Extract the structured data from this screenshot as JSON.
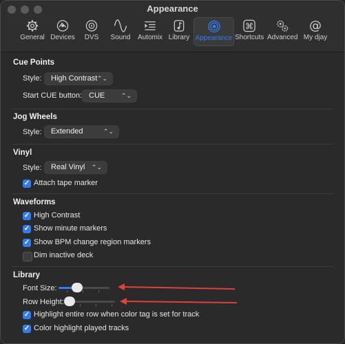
{
  "window": {
    "title": "Appearance"
  },
  "toolbar": {
    "items": [
      {
        "label": "General",
        "icon": "gear-icon"
      },
      {
        "label": "Devices",
        "icon": "headphones-icon"
      },
      {
        "label": "DVS",
        "icon": "vinyl-icon"
      },
      {
        "label": "Sound",
        "icon": "waveform-icon"
      },
      {
        "label": "Automix",
        "icon": "automix-icon"
      },
      {
        "label": "Library",
        "icon": "music-note-icon"
      },
      {
        "label": "Appearance",
        "icon": "eye-icon"
      },
      {
        "label": "Shortcuts",
        "icon": "command-key-icon"
      },
      {
        "label": "Advanced",
        "icon": "gears-icon"
      },
      {
        "label": "My djay",
        "icon": "at-sign-icon"
      }
    ],
    "active": "Appearance"
  },
  "cue_points": {
    "title": "Cue Points",
    "style_label": "Style:",
    "style_value": "High Contrast",
    "start_cue_label": "Start CUE button:",
    "start_cue_value": "CUE"
  },
  "jog_wheels": {
    "title": "Jog Wheels",
    "style_label": "Style:",
    "style_value": "Extended"
  },
  "vinyl": {
    "title": "Vinyl",
    "style_label": "Style:",
    "style_value": "Real Vinyl",
    "attach_tape_marker": {
      "label": "Attach tape marker",
      "checked": true
    }
  },
  "waveforms": {
    "title": "Waveforms",
    "high_contrast": {
      "label": "High Contrast",
      "checked": true
    },
    "show_minute_markers": {
      "label": "Show minute markers",
      "checked": true
    },
    "show_bpm_markers": {
      "label": "Show BPM change region markers",
      "checked": true
    },
    "dim_inactive_deck": {
      "label": "Dim inactive deck",
      "checked": false
    }
  },
  "library": {
    "title": "Library",
    "font_size": {
      "label": "Font Size:",
      "level": 0.33
    },
    "row_height": {
      "label": "Row Height:",
      "level": 0.0
    },
    "highlight_row": {
      "label": "Highlight entire row when color tag is set for track",
      "checked": true
    },
    "color_played": {
      "label": "Color highlight played tracks",
      "checked": true
    }
  },
  "colors": {
    "accent": "#2f7cf6",
    "annotation_arrow": "#e0423a"
  }
}
